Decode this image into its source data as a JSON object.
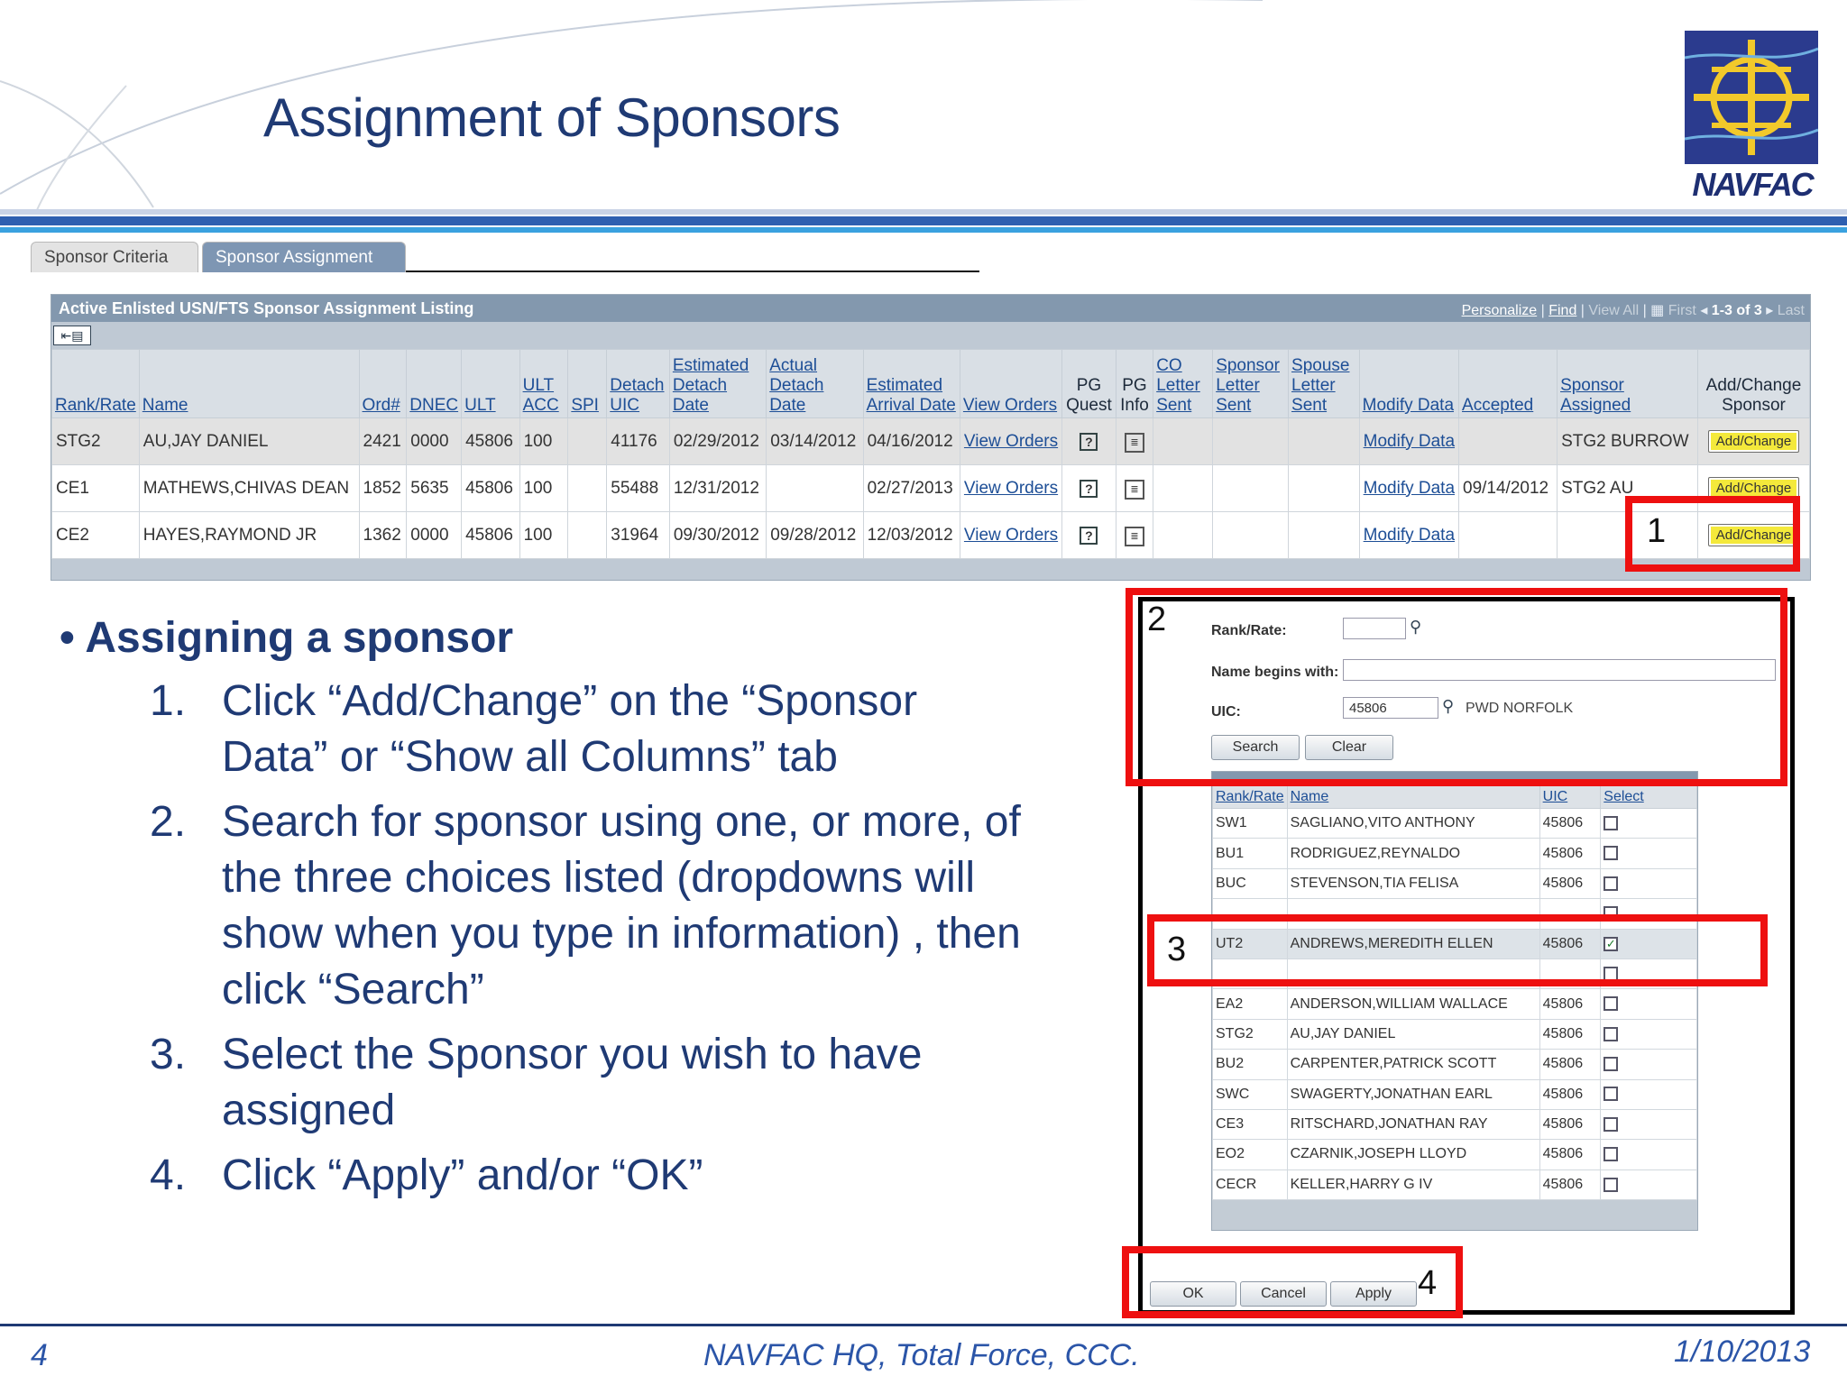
{
  "slide": {
    "title": "Assignment of Sponsors",
    "logo_text": "NAVFAC",
    "page_number": "4",
    "footer_center": "NAVFAC HQ, Total Force, CCC.",
    "footer_date": "1/10/2013"
  },
  "tabs": [
    {
      "label": "Sponsor Criteria"
    },
    {
      "label": "Sponsor Assignment"
    }
  ],
  "listing": {
    "title": "Active Enlisted USN/FTS Sponsor Assignment Listing",
    "nav": {
      "personalize": "Personalize",
      "find": "Find",
      "view_all": "View All",
      "first": "First",
      "range": "1-3 of 3",
      "last": "Last"
    },
    "columns": [
      {
        "label": "Rank/Rate"
      },
      {
        "label": "Name"
      },
      {
        "label": "Ord#"
      },
      {
        "label": "DNEC"
      },
      {
        "label": "ULT"
      },
      {
        "label": "ULT ACC"
      },
      {
        "label": "SPI"
      },
      {
        "label": "Detach UIC"
      },
      {
        "label": "Estimated Detach Date"
      },
      {
        "label": "Actual Detach Date"
      },
      {
        "label": "Estimated Arrival Date"
      },
      {
        "label": "View Orders"
      },
      {
        "label": "PG Quest"
      },
      {
        "label": "PG Info"
      },
      {
        "label": "CO Letter Sent"
      },
      {
        "label": "Sponsor Letter Sent"
      },
      {
        "label": "Spouse Letter Sent"
      },
      {
        "label": "Modify Data"
      },
      {
        "label": "Accepted"
      },
      {
        "label": "Sponsor Assigned"
      },
      {
        "label": "Add/Change Sponsor"
      }
    ],
    "rows": [
      {
        "rank": "STG2",
        "name": "AU,JAY DANIEL",
        "ord": "2421",
        "dnec": "0000",
        "ult": "45806",
        "ult_acc": "100",
        "spi": "",
        "detach_uic": "41176",
        "est_detach": "02/29/2012",
        "act_detach": "03/14/2012",
        "est_arrival": "04/16/2012",
        "view_orders": "View Orders",
        "modify": "Modify Data",
        "accepted": "",
        "sponsor": "STG2 BURROW",
        "add": "Add/Change"
      },
      {
        "rank": "CE1",
        "name": "MATHEWS,CHIVAS DEAN",
        "ord": "1852",
        "dnec": "5635",
        "ult": "45806",
        "ult_acc": "100",
        "spi": "",
        "detach_uic": "55488",
        "est_detach": "12/31/2012",
        "act_detach": "",
        "est_arrival": "02/27/2013",
        "view_orders": "View Orders",
        "modify": "Modify Data",
        "accepted": "09/14/2012",
        "sponsor": "STG2 AU",
        "add": "Add/Change"
      },
      {
        "rank": "CE2",
        "name": "HAYES,RAYMOND JR",
        "ord": "1362",
        "dnec": "0000",
        "ult": "45806",
        "ult_acc": "100",
        "spi": "",
        "detach_uic": "31964",
        "est_detach": "09/30/2012",
        "act_detach": "09/28/2012",
        "est_arrival": "12/03/2012",
        "view_orders": "View Orders",
        "modify": "Modify Data",
        "accepted": "",
        "sponsor": "",
        "add": "Add/Change"
      }
    ]
  },
  "callouts": {
    "one": "1",
    "two": "2",
    "three": "3",
    "four": "4"
  },
  "search": {
    "rank_label": "Rank/Rate:",
    "rank_value": "",
    "name_label": "Name begins with:",
    "name_value": "",
    "uic_label": "UIC:",
    "uic_value": "45806",
    "uic_desc": "PWD NORFOLK",
    "search_btn": "Search",
    "clear_btn": "Clear",
    "results_headers": [
      "Rank/Rate",
      "Name",
      "UIC",
      "Select"
    ],
    "results": [
      {
        "rank": "SW1",
        "name": "SAGLIANO,VITO ANTHONY",
        "uic": "45806",
        "checked": false
      },
      {
        "rank": "BU1",
        "name": "RODRIGUEZ,REYNALDO",
        "uic": "45806",
        "checked": false
      },
      {
        "rank": "BUC",
        "name": "STEVENSON,TIA FELISA",
        "uic": "45806",
        "checked": false
      },
      {
        "rank": "",
        "name": "",
        "uic": "",
        "checked": false
      },
      {
        "rank": "UT2",
        "name": "ANDREWS,MEREDITH ELLEN",
        "uic": "45806",
        "checked": true
      },
      {
        "rank": "",
        "name": "",
        "uic": "",
        "checked": false
      },
      {
        "rank": "EA2",
        "name": "ANDERSON,WILLIAM WALLACE",
        "uic": "45806",
        "checked": false
      },
      {
        "rank": "STG2",
        "name": "AU,JAY DANIEL",
        "uic": "45806",
        "checked": false
      },
      {
        "rank": "BU2",
        "name": "CARPENTER,PATRICK SCOTT",
        "uic": "45806",
        "checked": false
      },
      {
        "rank": "SWC",
        "name": "SWAGERTY,JONATHAN EARL",
        "uic": "45806",
        "checked": false
      },
      {
        "rank": "CE3",
        "name": "RITSCHARD,JONATHAN RAY",
        "uic": "45806",
        "checked": false
      },
      {
        "rank": "EO2",
        "name": "CZARNIK,JOSEPH LLOYD",
        "uic": "45806",
        "checked": false
      },
      {
        "rank": "CECR",
        "name": "KELLER,HARRY G IV",
        "uic": "45806",
        "checked": false
      }
    ],
    "ok_btn": "OK",
    "cancel_btn": "Cancel",
    "apply_btn": "Apply"
  },
  "bullets": {
    "heading": "Assigning a sponsor",
    "steps": [
      {
        "num": "1.",
        "lines": [
          "Click “Add/Change” on the “Sponsor",
          "Data” or “Show all Columns” tab"
        ]
      },
      {
        "num": "2.",
        "lines": [
          "Search for sponsor using one, or more,  of",
          "the three choices listed (dropdowns will",
          "show when you type in information) , then",
          "click “Search”"
        ]
      },
      {
        "num": "3.",
        "lines": [
          "Select the Sponsor you wish to have",
          "assigned"
        ]
      },
      {
        "num": "4.",
        "lines": [
          "Click “Apply” and/or “OK”"
        ]
      }
    ]
  },
  "colors": {
    "title": "#1f3a74",
    "header_bar": "#8398ae",
    "callout": "#ee1010",
    "add_button": "#f4e93b"
  },
  "icons": [
    "grid-icon",
    "help-icon",
    "form-icon",
    "magnifier-icon",
    "checkbox-icon",
    "first-arrow-icon",
    "last-arrow-icon"
  ]
}
